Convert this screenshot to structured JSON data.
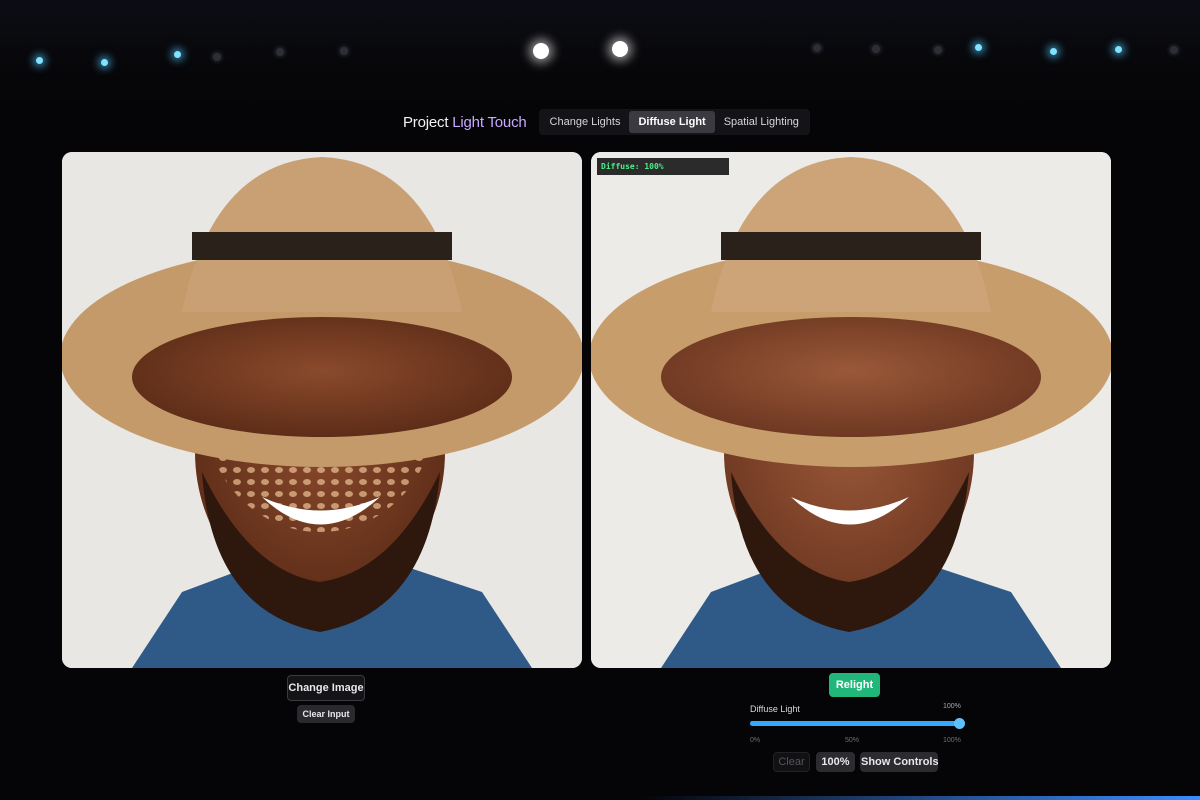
{
  "header": {
    "title_part1": "Project",
    "title_part2": "Light Touch",
    "tabs": [
      {
        "label": "Change Lights",
        "active": false
      },
      {
        "label": "Diffuse Light",
        "active": true
      },
      {
        "label": "Spatial Lighting",
        "active": false
      }
    ]
  },
  "left_panel": {
    "image": "portrait-dappled-shadow",
    "change_image_label": "Change Image",
    "clear_input_label": "Clear Input"
  },
  "right_panel": {
    "image": "portrait-diffused",
    "overlay_text": "Diffuse: 100%",
    "relight_label": "Relight"
  },
  "controls": {
    "slider_label": "Diffuse Light",
    "slider_value_label": "100%",
    "slider_value": 1.0,
    "ticks": [
      "0%",
      "50%",
      "100%"
    ],
    "clear_label": "Clear",
    "zoom_label": "100%",
    "show_controls_label": "Show Controls"
  },
  "colors": {
    "accent_green": "#21b77a",
    "slider_blue": "#35a8ff",
    "title_accent": "#c9a8ff",
    "overlay_text": "#4cf08a"
  }
}
